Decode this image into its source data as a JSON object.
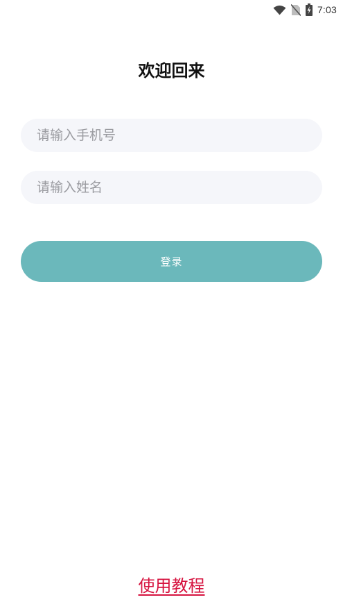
{
  "status_bar": {
    "time": "7:03",
    "icons": [
      "wifi-icon",
      "no-sim-icon",
      "battery-charging-icon"
    ]
  },
  "login": {
    "title": "欢迎回来",
    "phone_placeholder": "请输入手机号",
    "phone_value": "",
    "name_placeholder": "请输入姓名",
    "name_value": "",
    "login_button_label": "登录",
    "tutorial_link_label": "使用教程"
  },
  "colors": {
    "accent": "#6bb8bb",
    "link": "#d6133f",
    "input_background": "#f5f6fa",
    "placeholder": "#9a9ba0"
  }
}
